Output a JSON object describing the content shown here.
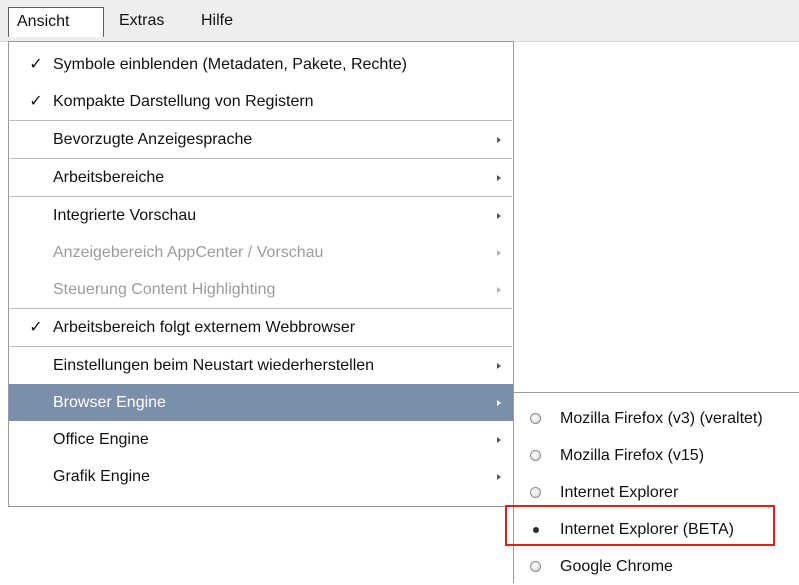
{
  "menubar": {
    "items": [
      {
        "label": "Ansicht"
      },
      {
        "label": "Extras"
      },
      {
        "label": "Hilfe"
      }
    ]
  },
  "ansicht_menu": {
    "items": [
      {
        "label": "Symbole einblenden (Metadaten, Pakete, Rechte)",
        "checked": true
      },
      {
        "label": "Kompakte Darstellung von Registern",
        "checked": true
      },
      {
        "label": "Bevorzugte Anzeigesprache",
        "submenu": true
      },
      {
        "label": "Arbeitsbereiche",
        "submenu": true
      },
      {
        "label": "Integrierte Vorschau",
        "submenu": true
      },
      {
        "label": "Anzeigebereich AppCenter / Vorschau",
        "submenu": true,
        "disabled": true
      },
      {
        "label": "Steuerung Content Highlighting",
        "submenu": true,
        "disabled": true
      },
      {
        "label": "Arbeitsbereich folgt externem Webbrowser",
        "checked": true
      },
      {
        "label": "Einstellungen beim Neustart wiederherstellen",
        "submenu": true
      },
      {
        "label": "Browser Engine",
        "submenu": true,
        "highlighted": true
      },
      {
        "label": "Office Engine",
        "submenu": true
      },
      {
        "label": "Grafik Engine",
        "submenu": true
      }
    ],
    "checkmark": "✓"
  },
  "browser_engine_submenu": {
    "items": [
      {
        "label": "Mozilla Firefox (v3) (veraltet)",
        "selected": false
      },
      {
        "label": "Mozilla Firefox (v15)",
        "selected": false
      },
      {
        "label": "Internet Explorer",
        "selected": false
      },
      {
        "label": "Internet Explorer (BETA)",
        "selected": true
      },
      {
        "label": "Google Chrome",
        "selected": false
      }
    ]
  },
  "colors": {
    "highlight": "#7b8fa9",
    "annotation": "#e02020",
    "disabled_text": "#9c9c9c",
    "menubar_bg": "#eeeeee"
  }
}
